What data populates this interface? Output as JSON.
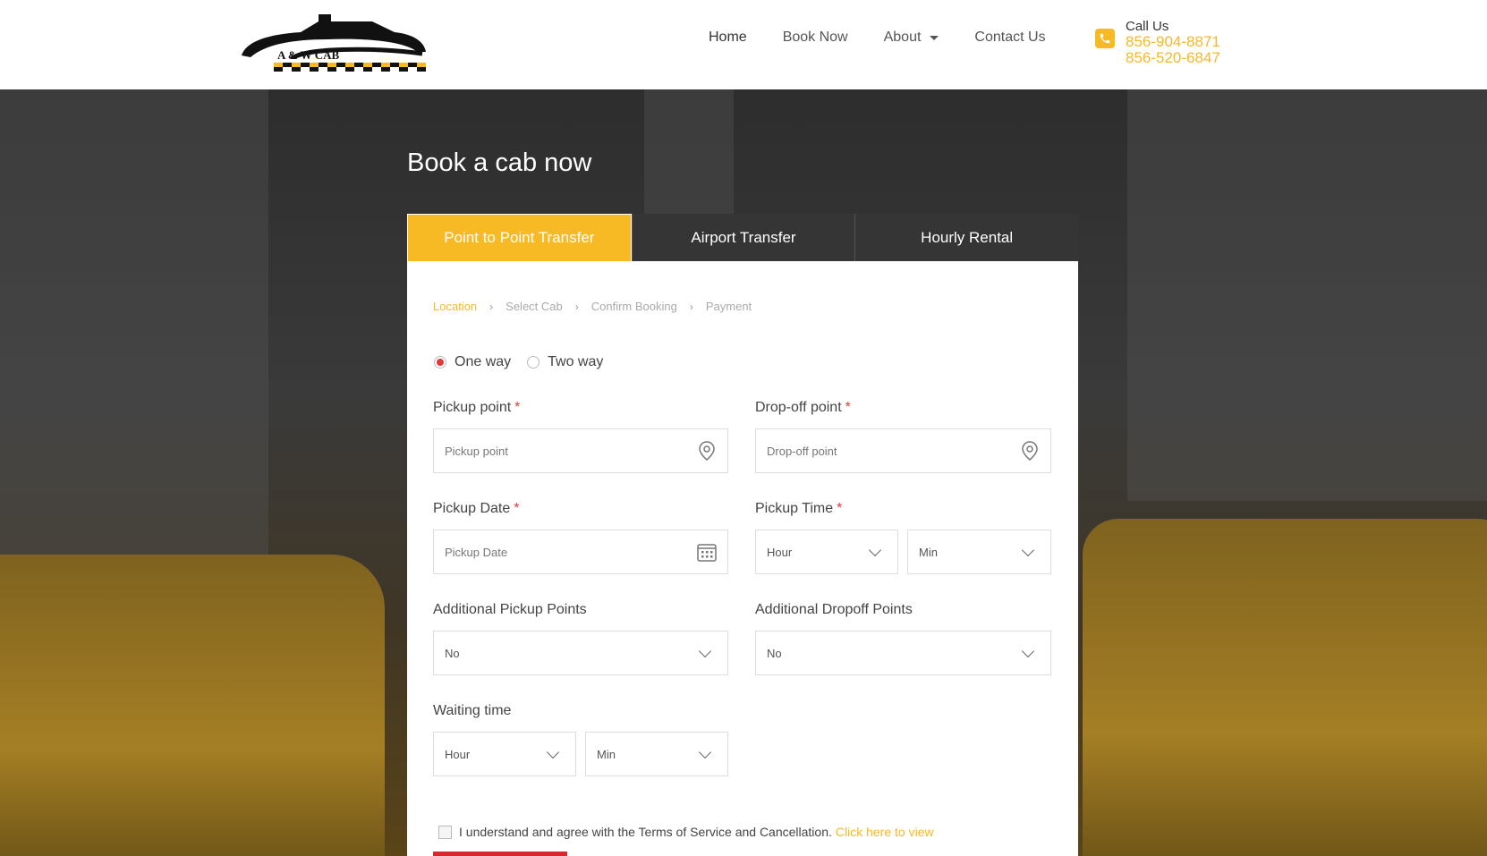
{
  "header": {
    "logo_text": "A & W CAB",
    "nav": [
      {
        "label": "Home"
      },
      {
        "label": "Book Now"
      },
      {
        "label": "About"
      },
      {
        "label": "Contact Us"
      }
    ],
    "call_label": "Call Us",
    "phone_1": "856-904-8871",
    "phone_2": "856-520-6847"
  },
  "booking": {
    "title": "Book a cab now",
    "tabs": [
      {
        "label": "Point to Point Transfer",
        "active": true
      },
      {
        "label": "Airport Transfer",
        "active": false
      },
      {
        "label": "Hourly Rental",
        "active": false
      }
    ],
    "steps": [
      "Location",
      "Select Cab",
      "Confirm Booking",
      "Payment"
    ],
    "trip_type": {
      "one_way": "One way",
      "two_way": "Two way",
      "selected": "One way"
    },
    "pickup_point": {
      "label": "Pickup point",
      "placeholder": "Pickup point"
    },
    "dropoff_point": {
      "label": "Drop-off point",
      "placeholder": "Drop-off point"
    },
    "pickup_date": {
      "label": "Pickup Date",
      "placeholder": "Pickup Date"
    },
    "pickup_time": {
      "label": "Pickup Time",
      "hour": "Hour",
      "min": "Min"
    },
    "additional_pickup": {
      "label": "Additional Pickup Points",
      "value": "No"
    },
    "additional_dropoff": {
      "label": "Additional Dropoff Points",
      "value": "No"
    },
    "waiting_time": {
      "label": "Waiting time",
      "hour": "Hour",
      "min": "Min"
    },
    "required_mark": "*",
    "terms_text": "I understand and agree with the Terms of Service and Cancellation.",
    "terms_link": "Click here to view"
  },
  "colors": {
    "accent": "#f7b924",
    "required": "#e03a3a",
    "tab_dark": "#353535"
  }
}
